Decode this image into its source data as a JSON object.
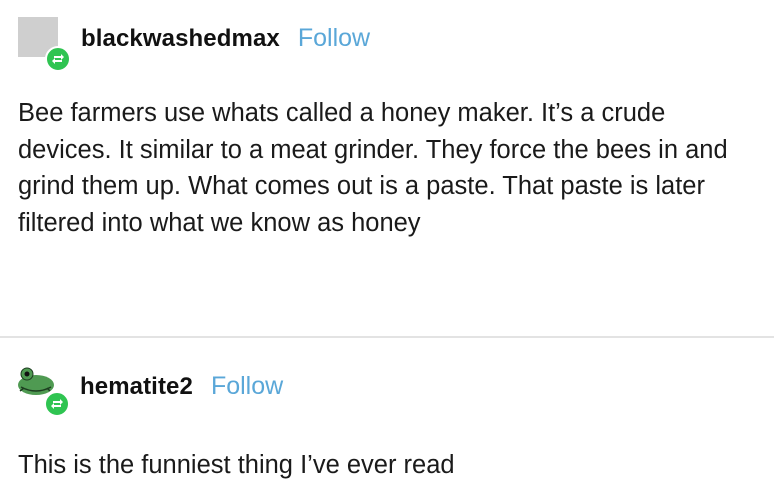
{
  "posts": [
    {
      "username": "blackwashedmax",
      "follow_label": "Follow",
      "body": "Bee farmers use whats called a honey maker. It’s a crude devices. It similar to a meat grinder. They force the bees in and grind them up. What comes out is a paste. That paste is later filtered into what we know as honey"
    },
    {
      "username": "hematite2",
      "follow_label": "Follow",
      "body": "This is the funniest thing I’ve ever read"
    }
  ],
  "colors": {
    "follow": "#5aa7d8",
    "reblog_badge": "#2fc451",
    "avatar_placeholder": "#cfcfcf",
    "divider": "#e3e3e3"
  },
  "icons": {
    "reblog": "reblog-icon",
    "avatar_default": "default-avatar-icon",
    "avatar_frog": "frog-avatar-icon"
  }
}
